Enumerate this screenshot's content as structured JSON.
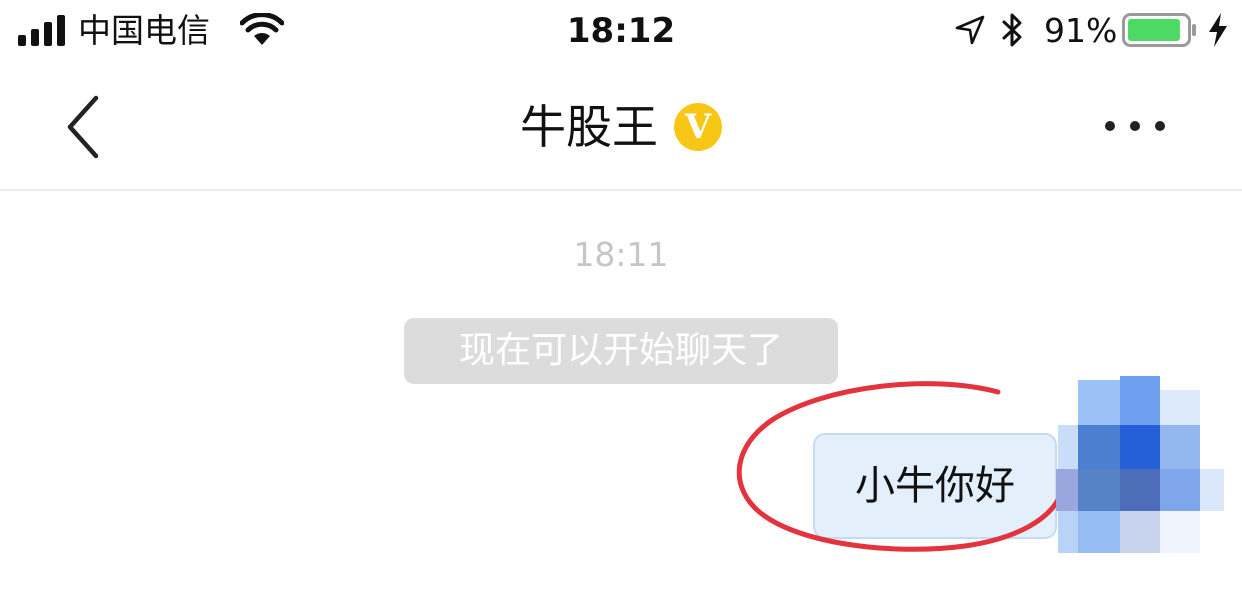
{
  "status_bar": {
    "carrier": "中国电信",
    "time": "18:12",
    "battery_percent": "91%",
    "battery_level": 0.91,
    "icons": [
      "signal-icon",
      "wifi-icon",
      "location-arrow-icon",
      "bluetooth-icon",
      "battery-icon",
      "charging-bolt-icon"
    ]
  },
  "nav": {
    "title": "牛股王",
    "verified_badge": "V",
    "back_icon": "chevron-left-icon",
    "more_icon": "more-dots-icon"
  },
  "chat": {
    "timestamp": "18:11",
    "system_message": "现在可以开始聊天了",
    "messages": [
      {
        "sender": "me",
        "text": "小牛你好"
      }
    ]
  },
  "colors": {
    "verified_badge": "#f8c615",
    "bubble_fill": "#e3effb",
    "bubble_border": "#c4dbf0",
    "system_bubble": "#dcdcdc",
    "battery_fill": "#4cd964",
    "annotation_circle": "#e2333f"
  }
}
